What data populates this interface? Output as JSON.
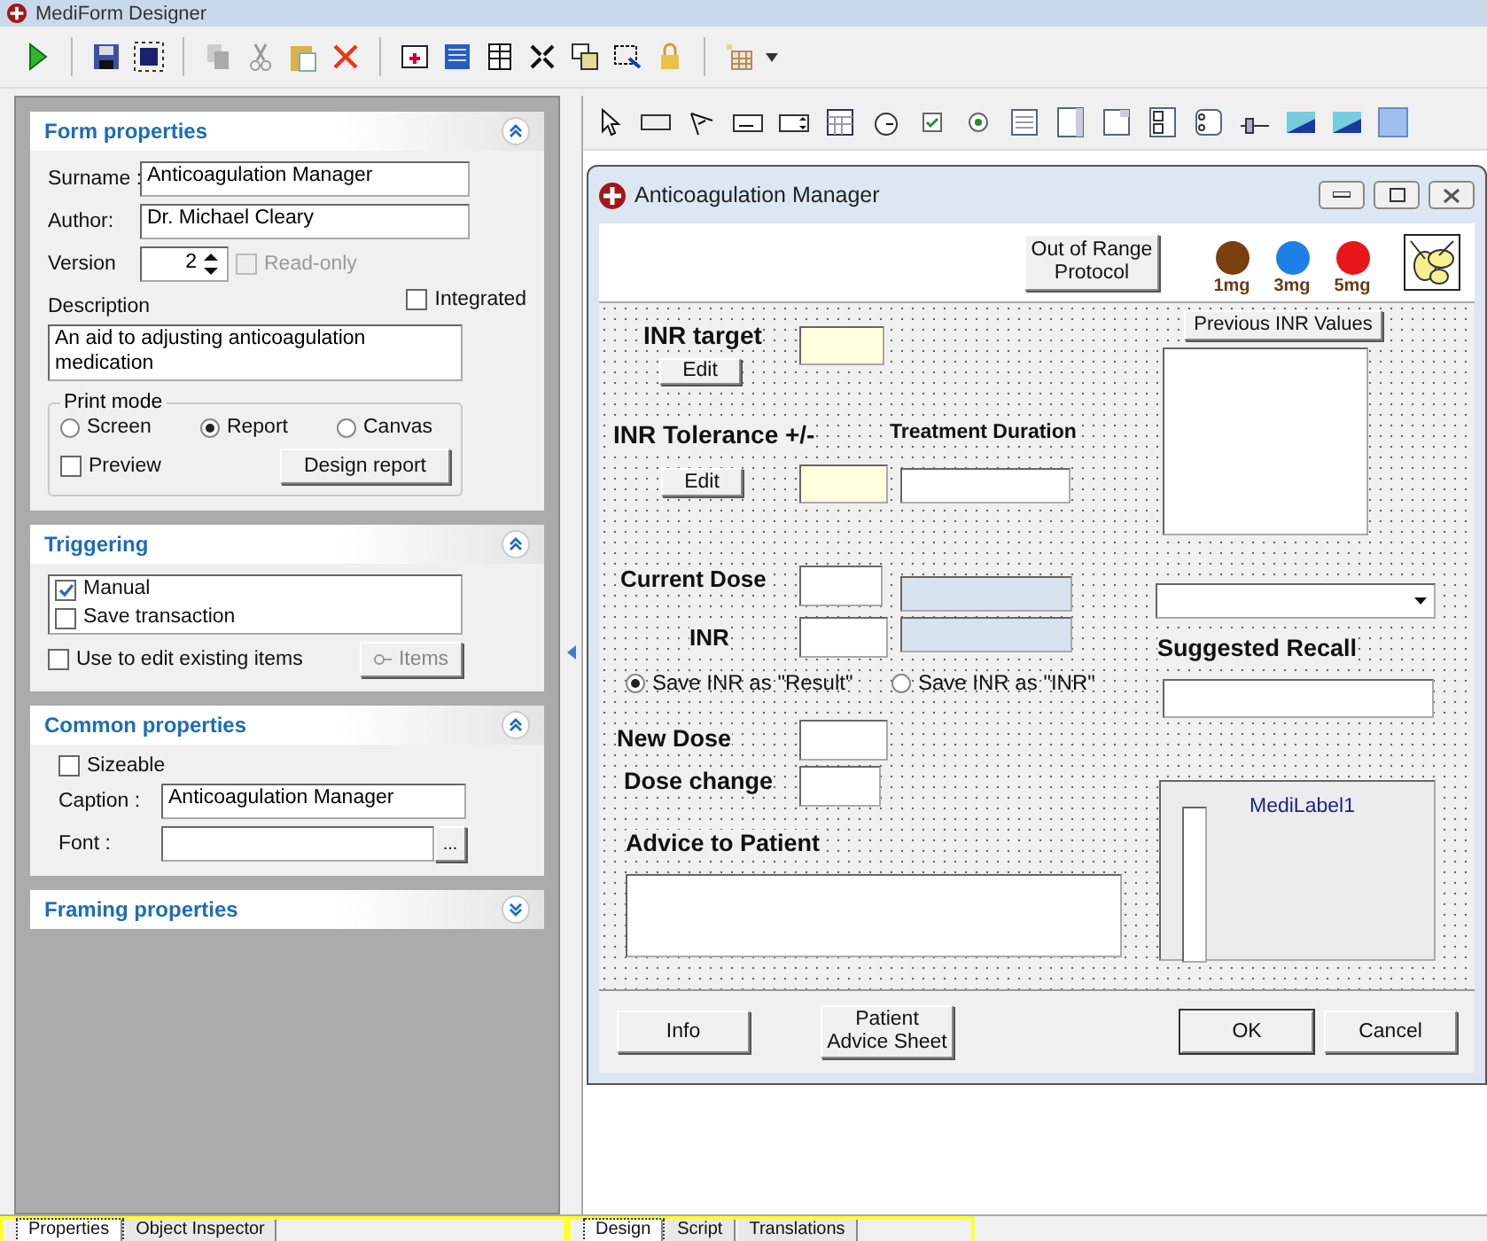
{
  "window": {
    "title": "MediForm Designer"
  },
  "form_properties": {
    "title": "Form properties",
    "expanded": true,
    "surname_label": "Surname :",
    "surname": "Anticoagulation Manager",
    "author_label": "Author:",
    "author": "Dr. Michael Cleary",
    "version_label": "Version",
    "version": "2",
    "read_only": {
      "label": "Read-only",
      "checked": false,
      "disabled": true
    },
    "integrated": {
      "label": "Integrated",
      "checked": false
    },
    "description_label": "Description",
    "description": "An aid to adjusting anticoagulation medication",
    "print_mode": {
      "title": "Print mode",
      "options": [
        {
          "label": "Screen",
          "selected": false
        },
        {
          "label": "Report",
          "selected": true
        },
        {
          "label": "Canvas",
          "selected": false
        }
      ],
      "preview": {
        "label": "Preview",
        "checked": false
      },
      "design_button": "Design report"
    }
  },
  "triggering": {
    "title": "Triggering",
    "expanded": true,
    "items": [
      {
        "label": "Manual",
        "checked": true
      },
      {
        "label": "Save transaction",
        "checked": false
      }
    ],
    "edit_existing": {
      "label": "Use to edit existing items",
      "checked": false
    },
    "items_button": "Items"
  },
  "common_properties": {
    "title": "Common properties",
    "expanded": true,
    "sizeable": {
      "label": "Sizeable",
      "checked": false
    },
    "caption_label": "Caption :",
    "caption": "Anticoagulation Manager",
    "font_label": "Font :",
    "font_button": "..."
  },
  "framing_properties": {
    "title": "Framing properties",
    "expanded": false
  },
  "form": {
    "title": "Anticoagulation Manager",
    "protocol_button": "Out of Range Protocol",
    "doses": [
      {
        "label": "1mg",
        "color": "#7a3f0e"
      },
      {
        "label": "3mg",
        "color": "#1e7fe6"
      },
      {
        "label": "5mg",
        "color": "#e8151b"
      }
    ],
    "inr_target": {
      "label": "INR target",
      "button": "Edit"
    },
    "inr_tolerance": {
      "label": "INR Tolerance +/-",
      "button": "Edit"
    },
    "treatment_duration_label": "Treatment Duration",
    "previous_inr_button": "Previous INR Values",
    "current_dose_label": "Current Dose",
    "inr_label": "INR",
    "save_options": [
      {
        "label": "Save INR as \"Result\"",
        "selected": true
      },
      {
        "label": "Save INR as \"INR\"",
        "selected": false
      }
    ],
    "suggested_recall_label": "Suggested Recall",
    "new_dose_label": "New Dose",
    "dose_change_label": "Dose change",
    "advice_label": "Advice to Patient",
    "medi_label": "MediLabel1",
    "footer_buttons": [
      {
        "label": "Info",
        "default": false
      },
      {
        "label": "Patient Advice Sheet",
        "default": false
      },
      {
        "label": "OK",
        "default": true
      },
      {
        "label": "Cancel",
        "default": false
      }
    ]
  },
  "bottom_tabs": {
    "left": [
      {
        "label": "Properties",
        "selected": true
      },
      {
        "label": "Object Inspector",
        "selected": false
      }
    ],
    "right": [
      {
        "label": "Design",
        "selected": true
      },
      {
        "label": "Script",
        "selected": false
      },
      {
        "label": "Translations",
        "selected": false
      }
    ]
  }
}
